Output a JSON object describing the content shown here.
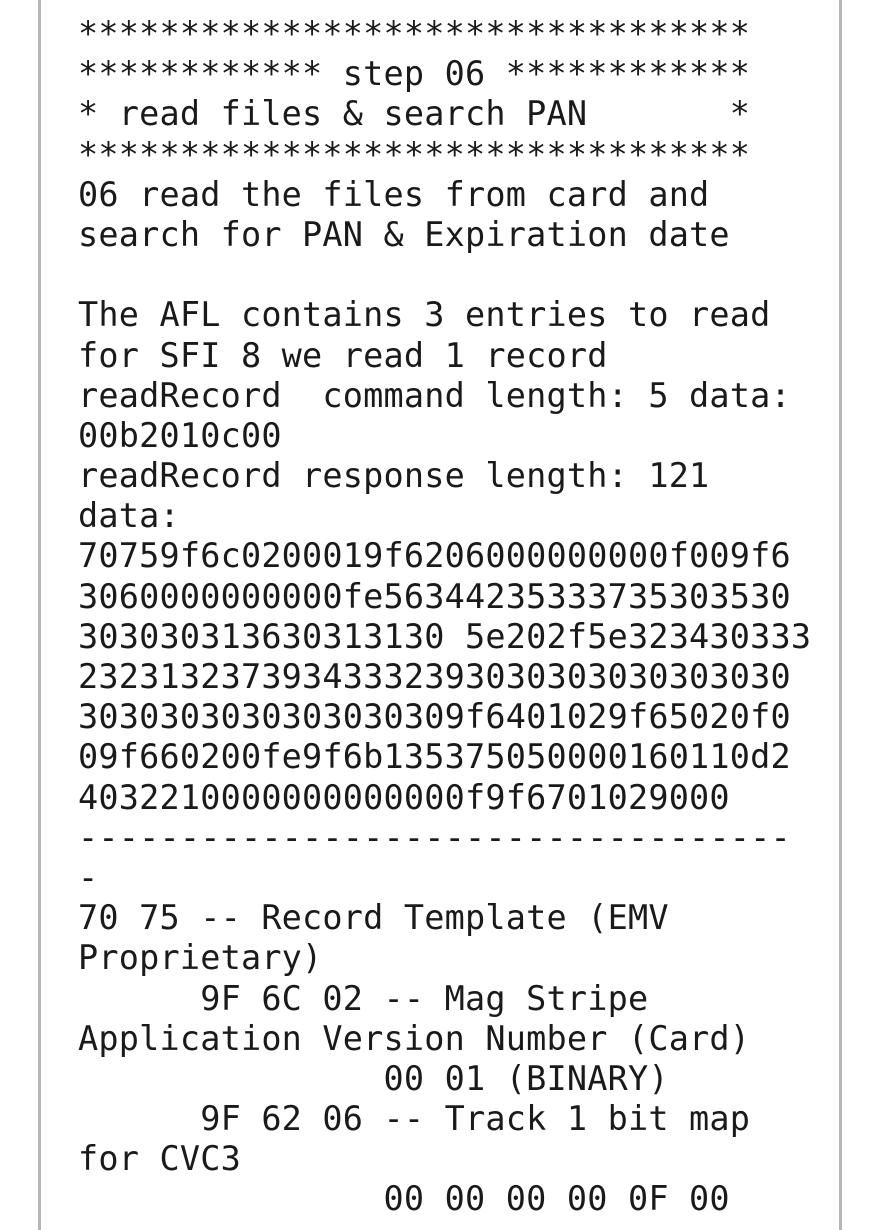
{
  "log": {
    "lines": [
      "*********************************",
      "************ step 06 ************",
      "* read files & search PAN       *",
      "*********************************",
      "06 read the files from card and",
      "search for PAN & Expiration date",
      "",
      "The AFL contains 3 entries to read",
      "for SFI 8 we read 1 record",
      "readRecord  command length: 5 data:",
      "00b2010c00",
      "readRecord response length: 121",
      "data:",
      "70759f6c0200019f6206000000000f009f6",
      "3060000000000fe56344235333735303530",
      "303030313630313130 5e202f5e323430333",
      "23231323739343332393030303030303030",
      "3030303030303030309f6401029f65020f0",
      "09f660200fe9f6b135375050000160110d2",
      "4032210000000000000f9f6701029000",
      "-----------------------------------",
      "-",
      "70 75 -- Record Template (EMV",
      "Proprietary)",
      "      9F 6C 02 -- Mag Stripe",
      "Application Version Number (Card)",
      "               00 01 (BINARY)",
      "      9F 62 06 -- Track 1 bit map",
      "for CVC3",
      "               00 00 00 00 0F 00"
    ]
  }
}
